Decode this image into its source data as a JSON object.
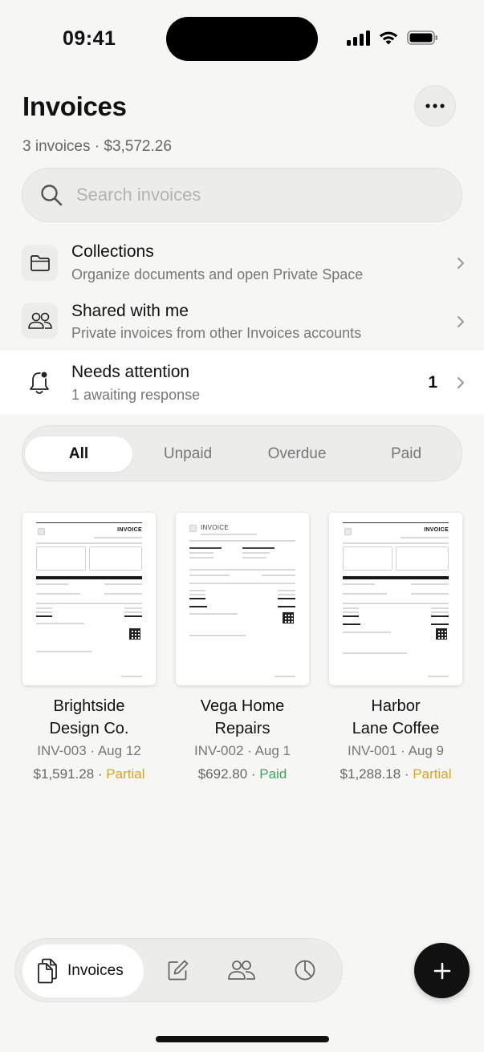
{
  "status_bar": {
    "time": "09:41"
  },
  "header": {
    "title": "Invoices",
    "subtitle": "3 invoices · $3,572.26",
    "more_icon": "ellipsis-icon"
  },
  "search": {
    "placeholder": "Search invoices",
    "icon": "search-icon"
  },
  "rows": {
    "collections": {
      "title": "Collections",
      "subtitle": "Organize documents and open Private Space",
      "icon": "folder-icon"
    },
    "shared": {
      "title": "Shared with me",
      "subtitle": "Private invoices from other Invoices accounts",
      "icon": "people-icon"
    },
    "attention": {
      "title": "Needs attention",
      "subtitle": "1 awaiting response",
      "count": "1",
      "icon": "bell-icon"
    }
  },
  "filters": {
    "tabs": [
      "All",
      "Unpaid",
      "Overdue",
      "Paid"
    ],
    "selected": "All"
  },
  "invoices": [
    {
      "client_line1": "Brightside",
      "client_line2": "Design Co.",
      "meta": "INV-003 · Aug 12",
      "amount": "$1,591.28",
      "sep": " · ",
      "status": "Partial",
      "status_color": "#e0a21c"
    },
    {
      "client_line1": "Vega Home",
      "client_line2": "Repairs",
      "meta": "INV-002 · Aug 1",
      "amount": "$692.80",
      "sep": " · ",
      "status": "Paid",
      "status_color": "#3ba55c"
    },
    {
      "client_line1": "Harbor",
      "client_line2": "Lane Coffee",
      "meta": "INV-001 · Aug 9",
      "amount": "$1,288.18",
      "sep": " · ",
      "status": "Partial",
      "status_color": "#e0a21c"
    }
  ],
  "thumbnails": {
    "bold_title": "INVOICE",
    "light_title": "INVOICE"
  },
  "tabbar": {
    "active_label": "Invoices",
    "tabs": [
      "invoices-icon",
      "edit-icon",
      "clients-icon",
      "reports-icon"
    ]
  },
  "fab": {
    "icon": "plus-icon"
  },
  "colors": {
    "background": "#f6f6f4",
    "partial": "#e0a21c",
    "paid": "#3ba55c",
    "accent": "#111111"
  }
}
